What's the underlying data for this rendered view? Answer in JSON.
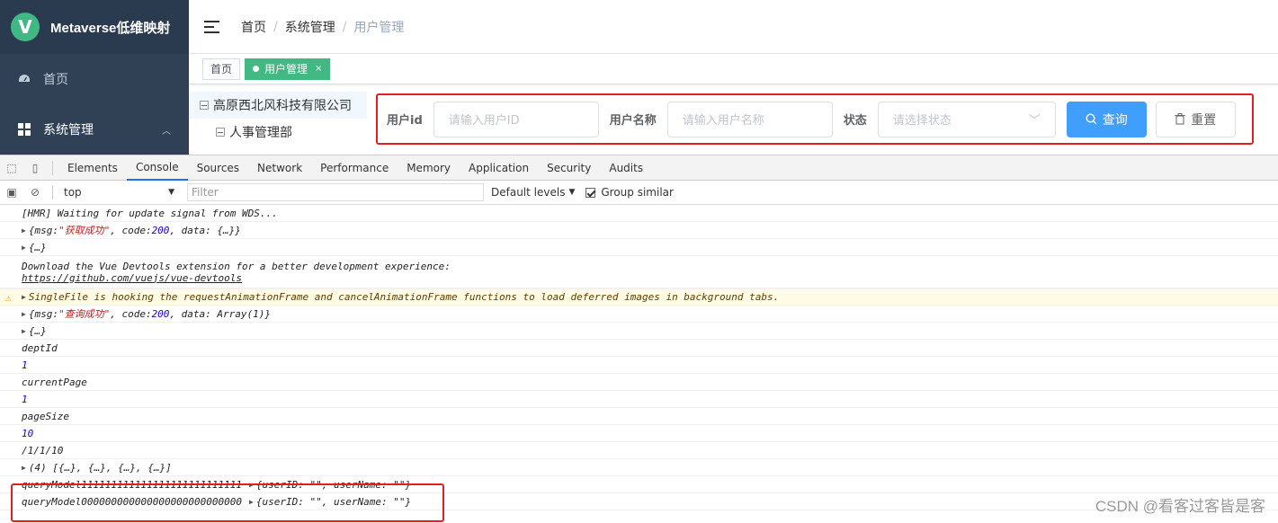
{
  "app": {
    "logo_letter": "V",
    "title": "Metaverse低维映射",
    "menu": [
      {
        "label": "首页",
        "icon": "dashboard-icon"
      },
      {
        "label": "系统管理",
        "icon": "grid-icon"
      }
    ],
    "breadcrumb": [
      "首页",
      "系统管理",
      "用户管理"
    ],
    "tags": [
      {
        "label": "首页",
        "active": false
      },
      {
        "label": "用户管理",
        "active": true
      }
    ],
    "tree": [
      "高原西北风科技有限公司",
      "人事管理部"
    ],
    "search": {
      "userid_label": "用户id",
      "userid_placeholder": "请输入用户ID",
      "username_label": "用户名称",
      "username_placeholder": "请输入用户名称",
      "status_label": "状态",
      "status_placeholder": "请选择状态",
      "query_button": "查询",
      "reset_button": "重置"
    },
    "accent_color": "#42b983",
    "primary_color": "#409eff"
  },
  "devtools": {
    "tabs": [
      "Elements",
      "Console",
      "Sources",
      "Network",
      "Performance",
      "Memory",
      "Application",
      "Security",
      "Audits"
    ],
    "active_tab": "Console",
    "context": "top",
    "filter_placeholder": "Filter",
    "levels": "Default levels",
    "group_similar": "Group similar",
    "logs": {
      "l1": "[HMR] Waiting for update signal from WDS...",
      "l2_a": "{msg: ",
      "l2_b": "\"获取成功\"",
      "l2_c": ", code: ",
      "l2_d": "200",
      "l2_e": ", data: {…}}",
      "l3": "{…}",
      "l4_a": "Download the Vue Devtools extension for a better development experience:",
      "l4_b": "https://github.com/vuejs/vue-devtools",
      "l5": "SingleFile is hooking the requestAnimationFrame and cancelAnimationFrame functions to load deferred images in background tabs.",
      "l6_a": "{msg: ",
      "l6_b": "\"查询成功\"",
      "l6_c": ", code: ",
      "l6_d": "200",
      "l6_e": ", data: Array(1)}",
      "l7": "{…}",
      "l8": "deptId",
      "l9": "1",
      "l10": "currentPage",
      "l11": "1",
      "l12": "pageSize",
      "l13": "10",
      "l14": "/1/1/10",
      "l15": "(4) [{…}, {…}, {…}, {…}]",
      "l16_a": "queryModel111111111111111111111111111",
      "l16_b": "{userID: \"\", userName: \"\"}",
      "l17_a": "queryModel000000000000000000000000000",
      "l17_b": "{userID: \"\", userName: \"\"}"
    }
  },
  "watermark": "CSDN @看客过客皆是客"
}
